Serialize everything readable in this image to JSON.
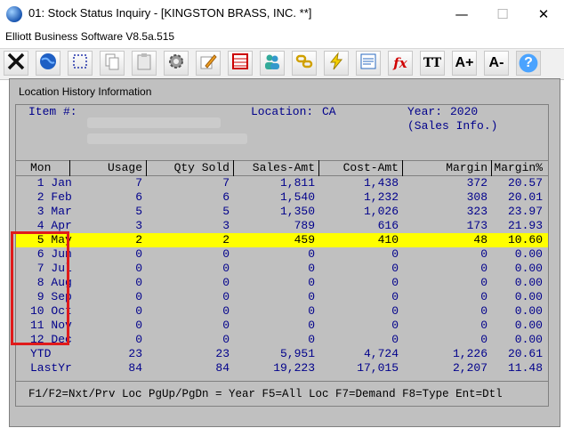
{
  "window": {
    "title": "01: Stock Status Inquiry - [KINGSTON BRASS, INC. **]",
    "minimize_glyph": "—",
    "maximize_glyph": "☐",
    "close_glyph": "✕"
  },
  "app": {
    "name": "Elliott Business Software V8.5a.515"
  },
  "toolbar": {
    "buttons": [
      {
        "icon": "close-x-icon"
      },
      {
        "icon": "globe-icon"
      },
      {
        "icon": "select-icon"
      },
      {
        "icon": "copy-icon"
      },
      {
        "icon": "paste-icon"
      },
      {
        "icon": "gear-icon"
      },
      {
        "icon": "edit-icon"
      },
      {
        "icon": "spreadsheet-icon"
      },
      {
        "icon": "users-icon"
      },
      {
        "icon": "link-icon"
      },
      {
        "icon": "lightning-icon"
      },
      {
        "icon": "notes-icon"
      },
      {
        "icon": "function-icon"
      },
      {
        "icon": "font-icon"
      },
      {
        "icon": "font-bigger-icon"
      },
      {
        "icon": "font-smaller-icon"
      },
      {
        "icon": "help-icon"
      }
    ],
    "fx_label": "fx",
    "font_label": "TT",
    "font_up_label": "A+",
    "font_down_label": "A-",
    "help_label": "?"
  },
  "dialog": {
    "title": "Location History Information",
    "item_label": "Item #:",
    "location_label": "Location:",
    "location_value": "CA",
    "year_label": "Year:",
    "year_value": "2020",
    "mode": "(Sales Info.)",
    "columns": [
      "Mon",
      "Usage",
      "Qty Sold",
      "Sales-Amt",
      "Cost-Amt",
      "Margin",
      "Margin%"
    ],
    "rows": [
      {
        "mon": " 1 Jan",
        "usage": "7",
        "qty": "7",
        "sales": "1,811",
        "cost": "1,438",
        "margin": "372",
        "pct": "20.57"
      },
      {
        "mon": " 2 Feb",
        "usage": "6",
        "qty": "6",
        "sales": "1,540",
        "cost": "1,232",
        "margin": "308",
        "pct": "20.01"
      },
      {
        "mon": " 3 Mar",
        "usage": "5",
        "qty": "5",
        "sales": "1,350",
        "cost": "1,026",
        "margin": "323",
        "pct": "23.97"
      },
      {
        "mon": " 4 Apr",
        "usage": "3",
        "qty": "3",
        "sales": "789",
        "cost": "616",
        "margin": "173",
        "pct": "21.93"
      },
      {
        "mon": " 5 May",
        "usage": "2",
        "qty": "2",
        "sales": "459",
        "cost": "410",
        "margin": "48",
        "pct": "10.60"
      },
      {
        "mon": " 6 Jun",
        "usage": "0",
        "qty": "0",
        "sales": "0",
        "cost": "0",
        "margin": "0",
        "pct": "0.00"
      },
      {
        "mon": " 7 Jul",
        "usage": "0",
        "qty": "0",
        "sales": "0",
        "cost": "0",
        "margin": "0",
        "pct": "0.00"
      },
      {
        "mon": " 8 Aug",
        "usage": "0",
        "qty": "0",
        "sales": "0",
        "cost": "0",
        "margin": "0",
        "pct": "0.00"
      },
      {
        "mon": " 9 Sep",
        "usage": "0",
        "qty": "0",
        "sales": "0",
        "cost": "0",
        "margin": "0",
        "pct": "0.00"
      },
      {
        "mon": "10 Oct",
        "usage": "0",
        "qty": "0",
        "sales": "0",
        "cost": "0",
        "margin": "0",
        "pct": "0.00"
      },
      {
        "mon": "11 Nov",
        "usage": "0",
        "qty": "0",
        "sales": "0",
        "cost": "0",
        "margin": "0",
        "pct": "0.00"
      },
      {
        "mon": "12 Dec",
        "usage": "0",
        "qty": "0",
        "sales": "0",
        "cost": "0",
        "margin": "0",
        "pct": "0.00"
      },
      {
        "mon": "YTD",
        "usage": "23",
        "qty": "23",
        "sales": "5,951",
        "cost": "4,724",
        "margin": "1,226",
        "pct": "20.61"
      },
      {
        "mon": "LastYr",
        "usage": "84",
        "qty": "84",
        "sales": "19,223",
        "cost": "17,015",
        "margin": "2,207",
        "pct": "11.48"
      }
    ],
    "selected_row": 4,
    "footer": "F1/F2=Nxt/Prv Loc PgUp/PgDn = Year F5=All Loc F7=Demand F8=Type Ent=Dtl"
  },
  "colors": {
    "highlight": "#ffff00",
    "screen_bg": "#c0c0c0",
    "text": "#00008b",
    "annotation": "#e01b1b"
  }
}
